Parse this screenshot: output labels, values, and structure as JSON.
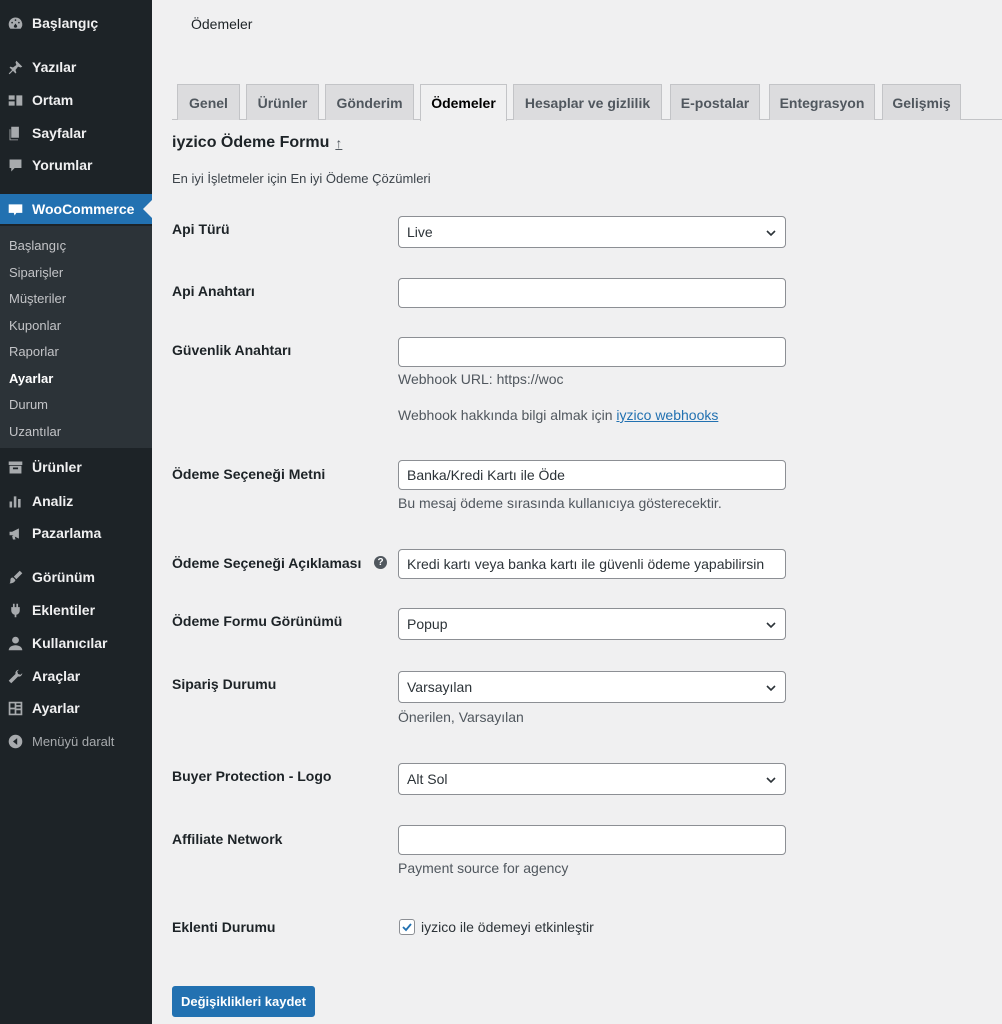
{
  "sidebar": {
    "top_items": [
      {
        "label": "Başlangıç",
        "icon": "dashboard-icon"
      },
      {
        "label": "Yazılar",
        "icon": "pin-icon"
      },
      {
        "label": "Ortam",
        "icon": "media-icon"
      },
      {
        "label": "Sayfalar",
        "icon": "pages-icon"
      },
      {
        "label": "Yorumlar",
        "icon": "comments-icon"
      }
    ],
    "woocommerce": {
      "label": "WooCommerce",
      "icon": "woocommerce-icon"
    },
    "submenu": [
      "Başlangıç",
      "Siparişler",
      "Müşteriler",
      "Kuponlar",
      "Raporlar",
      "Ayarlar",
      "Durum",
      "Uzantılar"
    ],
    "submenu_current": "Ayarlar",
    "bottom_items": [
      {
        "label": "Ürünler",
        "icon": "archive-icon"
      },
      {
        "label": "Analiz",
        "icon": "bar-chart-icon"
      },
      {
        "label": "Pazarlama",
        "icon": "megaphone-icon"
      },
      {
        "label": "Görünüm",
        "icon": "brush-icon"
      },
      {
        "label": "Eklentiler",
        "icon": "plugin-icon"
      },
      {
        "label": "Kullanıcılar",
        "icon": "users-icon"
      },
      {
        "label": "Araçlar",
        "icon": "wrench-icon"
      },
      {
        "label": "Ayarlar",
        "icon": "settings-icon"
      }
    ],
    "collapse": {
      "label": "Menüyü daralt",
      "icon": "collapse-icon"
    },
    "colors": {
      "bg": "#1d2327",
      "active": "#2271b1",
      "submenu_bg": "#2c3338"
    }
  },
  "page": {
    "title": "Ödemeler",
    "tabs": [
      "Genel",
      "Ürünler",
      "Gönderim",
      "Ödemeler",
      "Hesaplar ve gizlilik",
      "E-postalar",
      "Entegrasyon",
      "Gelişmiş"
    ],
    "active_tab": "Ödemeler",
    "section_title": "iyzico Ödeme Formu",
    "section_up_icon": "↑",
    "section_desc": "En iyi İşletmeler için En iyi Ödeme Çözümleri"
  },
  "form": {
    "api_type": {
      "label": "Api Türü",
      "value": "Live"
    },
    "api_key": {
      "label": "Api Anahtarı",
      "value": ""
    },
    "secret_key": {
      "label": "Güvenlik Anahtarı",
      "value": "",
      "webhook_url": "Webhook URL: https://woc",
      "webhook_info": "Webhook hakkında bilgi almak için",
      "webhook_link": "iyzico webhooks"
    },
    "option_text": {
      "label": "Ödeme Seçeneği Metni",
      "value": "Banka/Kredi Kartı ile Öde",
      "help": "Bu mesaj ödeme sırasında kullanıcıya gösterecektir."
    },
    "option_desc": {
      "label": "Ödeme Seçeneği Açıklaması",
      "value": "Kredi kartı veya banka kartı ile güvenli ödeme yapabilirsin",
      "tip": "?"
    },
    "form_view": {
      "label": "Ödeme Formu Görünümü",
      "value": "Popup"
    },
    "order_status": {
      "label": "Sipariş Durumu",
      "value": "Varsayılan",
      "help": "Önerilen, Varsayılan"
    },
    "buyer_protection": {
      "label": "Buyer Protection - Logo",
      "value": "Alt Sol"
    },
    "affiliate": {
      "label": "Affiliate Network",
      "value": "",
      "help": "Payment source for agency"
    },
    "plugin_status": {
      "label": "Eklenti Durumu",
      "checkbox_label": "iyzico ile ödemeyi etkinleştir",
      "checked": true
    },
    "save_label": "Değişiklikleri kaydet"
  }
}
